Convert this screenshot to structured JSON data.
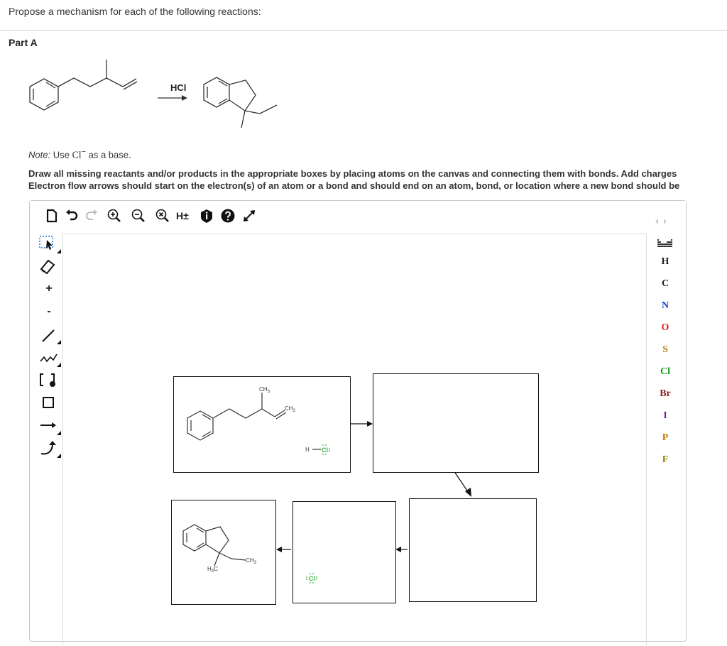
{
  "question": "Propose a mechanism for each of the following reactions:",
  "part_label": "Part A",
  "reaction": {
    "reagent": "HCl"
  },
  "note": {
    "prefix": "Note:",
    "text_before": "Use ",
    "ion": "Cl",
    "charge": "−",
    "text_after": " as a base."
  },
  "instructions": {
    "line1": "Draw all missing reactants and/or products in the appropriate boxes by placing atoms on the canvas and connecting them with bonds. Add charges",
    "line2": "Electron flow arrows should start on the electron(s) of an atom or a bond and should end on an atom, bond, or location where a new bond should be"
  },
  "toolbar": {
    "explicit_h_label": "H±"
  },
  "left_tools": {
    "plus": "+",
    "minus": "-"
  },
  "palette": {
    "elements": [
      {
        "symbol": "H",
        "color": "#222222"
      },
      {
        "symbol": "C",
        "color": "#222222"
      },
      {
        "symbol": "N",
        "color": "#1f3fbf"
      },
      {
        "symbol": "O",
        "color": "#e02020"
      },
      {
        "symbol": "S",
        "color": "#b8860b"
      },
      {
        "symbol": "Cl",
        "color": "#1a9a1a"
      },
      {
        "symbol": "Br",
        "color": "#8b1a1a"
      },
      {
        "symbol": "I",
        "color": "#7a1fa0"
      },
      {
        "symbol": "P",
        "color": "#c87800"
      },
      {
        "symbol": "F",
        "color": "#8a8a00"
      }
    ]
  },
  "canvas": {
    "box1": {
      "ch3_top": "CH",
      "ch2_end": "CH",
      "hcl_h": "H",
      "hcl_cl": "Cl"
    },
    "box4": {
      "h3c": "H",
      "h3c_c": "C",
      "ch3": "CH"
    },
    "chloride_label": "Cl",
    "sub3": "3",
    "sub2": "2"
  },
  "colors": {
    "chlorine": "#3cb043",
    "border": "#c8c8c8"
  }
}
